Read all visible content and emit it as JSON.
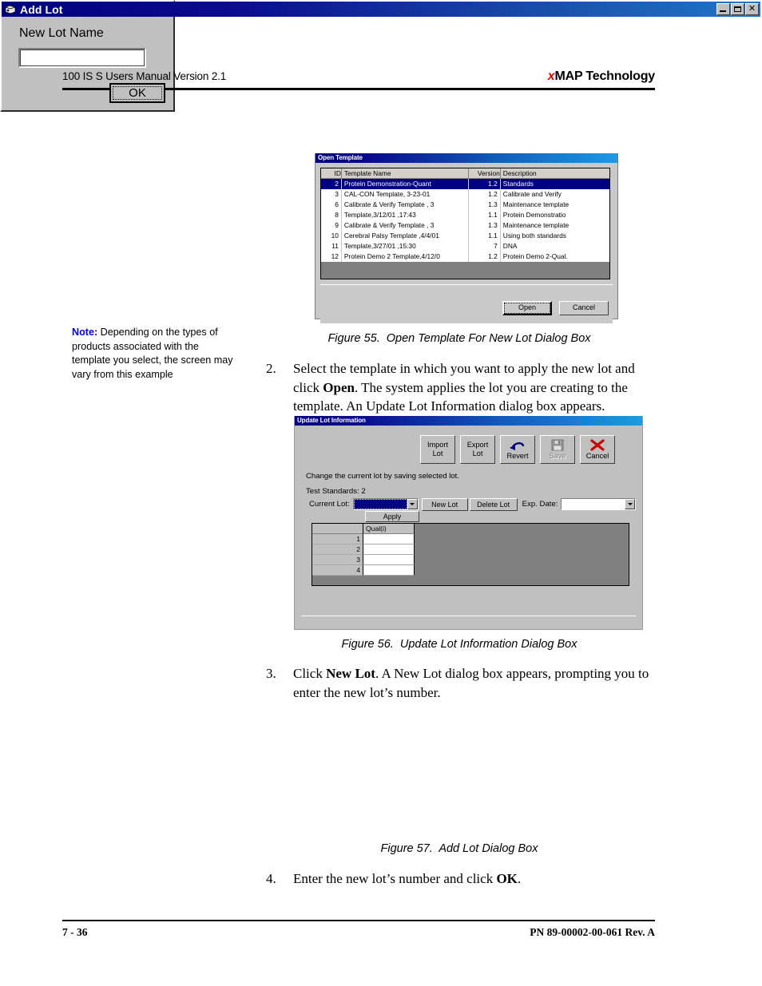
{
  "header": {
    "left": "100 IS S Users Manual Version 2.1",
    "right_italic_x": "x",
    "right_bold": "MAP Technology"
  },
  "footer": {
    "page_number": "7 - 36",
    "part_number": "PN 89-00002-00-061 Rev. A"
  },
  "note": {
    "label": "Note:",
    "text": " Depending on the types of products associated with the template you select, the screen may vary from this example"
  },
  "figure55": {
    "caption": "Figure 55.  Open Template For New Lot Dialog Box",
    "dialog": {
      "title": "Open Template",
      "columns": [
        "ID",
        "Template Name",
        "Version",
        "Description"
      ],
      "rows": [
        {
          "id": "2",
          "name": "Protein Demonstration-Quant",
          "version": "1.2",
          "description": "Standards",
          "selected": true
        },
        {
          "id": "3",
          "name": "CAL-CON Template, 3-23-01",
          "version": "1.2",
          "description": "Calibrate and Verify",
          "selected": false
        },
        {
          "id": "6",
          "name": "Calibrate & Verify Template , 3",
          "version": "1.3",
          "description": "Maintenance template",
          "selected": false
        },
        {
          "id": "8",
          "name": "Template,3/12/01 ,17:43",
          "version": "1.1",
          "description": "Protein Demonstratio",
          "selected": false
        },
        {
          "id": "9",
          "name": "Calibrate & Verify Template , 3",
          "version": "1.3",
          "description": "Maintenance template",
          "selected": false
        },
        {
          "id": "10",
          "name": "Cerebral Palsy Template ,4/4/01",
          "version": "1.1",
          "description": "Using both standards",
          "selected": false
        },
        {
          "id": "11",
          "name": "Template,3/27/01 ,15:30",
          "version": "7",
          "description": "DNA",
          "selected": false
        },
        {
          "id": "12",
          "name": "Protein Demo 2 Template,4/12/0",
          "version": "1.2",
          "description": "Protein Demo 2-Qual.",
          "selected": false
        }
      ],
      "open_button": "Open",
      "cancel_button": "Cancel"
    }
  },
  "step2": {
    "number": "2.",
    "part1": "Select the template in which you want to apply the new lot and click ",
    "bold1": "Open",
    "part2": ". The system applies the lot you are creating to the template. An Update Lot Information dialog box appears."
  },
  "figure56": {
    "caption": "Figure 56.  Update Lot Information Dialog Box",
    "dialog": {
      "title": "Update Lot Information",
      "toolbar": [
        {
          "name": "import-lot",
          "line1": "Import",
          "line2": "Lot",
          "icon": "none",
          "disabled": false
        },
        {
          "name": "export-lot",
          "line1": "Export",
          "line2": "Lot",
          "icon": "none",
          "disabled": false
        },
        {
          "name": "revert",
          "line1": "",
          "line2": "Revert",
          "icon": "undo-arrow-icon",
          "disabled": false
        },
        {
          "name": "save",
          "line1": "",
          "line2": "Save",
          "icon": "floppy-disk-icon",
          "disabled": true
        },
        {
          "name": "cancel",
          "line1": "",
          "line2": "Cancel",
          "icon": "red-x-icon",
          "disabled": false
        }
      ],
      "description": "Change the current lot by saving selected lot.",
      "test_standards": "Test Standards: 2",
      "current_lot_label": "Current Lot:",
      "current_lot_value": "",
      "new_lot_button": "New Lot",
      "delete_lot_button": "Delete Lot",
      "exp_date_label": "Exp. Date:",
      "exp_date_value": "",
      "apply_button": "Apply",
      "grid_column_header": "Qual(i)",
      "grid_row_headers": [
        "1",
        "2",
        "3",
        "4"
      ],
      "grid_cells": [
        "",
        "",
        "",
        ""
      ]
    }
  },
  "step3": {
    "number": "3.",
    "part1": "Click ",
    "bold1": "New Lot",
    "part2": ". A New Lot dialog box appears, prompting you to enter the new lot’s number."
  },
  "figure57": {
    "caption": "Figure 57.  Add Lot Dialog Box",
    "dialog": {
      "title": "Add Lot",
      "minimize_label": "_",
      "maximize_label": "□",
      "close_label": "✕",
      "field_label": "New Lot Name",
      "field_value": "",
      "ok_button": "OK"
    }
  },
  "step4": {
    "number": "4.",
    "part1": "Enter the new lot’s number and click ",
    "bold1": "OK",
    "part2": "."
  },
  "colors": {
    "title_bar_start": "#00007e",
    "title_bar_end": "#1e9ae4",
    "selection_blue": "#000080",
    "dialog_face": "#c0c0c0",
    "note_accent": "#0000cc",
    "brand_red": "#d60000"
  }
}
